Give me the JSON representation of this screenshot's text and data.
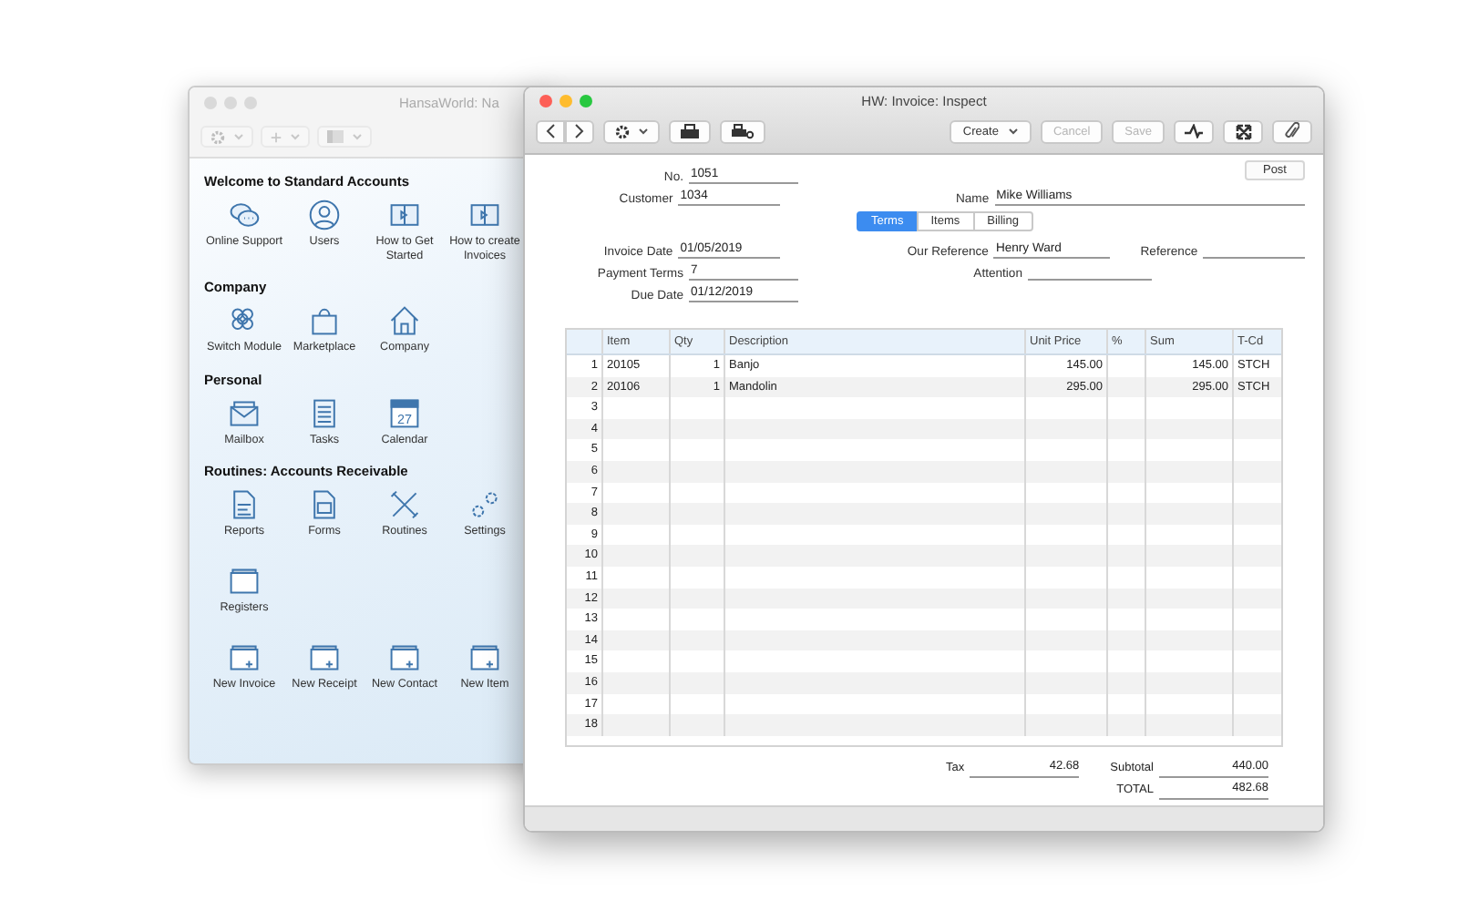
{
  "back_window": {
    "title": "HansaWorld: Na",
    "toolbar": [
      {
        "kind": "gear",
        "disabled": true
      },
      {
        "kind": "plus",
        "disabled": true
      },
      {
        "kind": "view",
        "disabled": true
      }
    ],
    "sections": [
      {
        "title": "Welcome to Standard Accounts",
        "items": [
          {
            "label": "Online Support",
            "kind": "chat"
          },
          {
            "label": "Users",
            "kind": "person"
          },
          {
            "label": "How to Get Started",
            "kind": "book"
          },
          {
            "label": "How to create Invoices",
            "kind": "book"
          }
        ]
      },
      {
        "title": "Company",
        "items": [
          {
            "label": "Switch Module",
            "kind": "cubes"
          },
          {
            "label": "Marketplace",
            "kind": "bag"
          },
          {
            "label": "Company",
            "kind": "house"
          }
        ]
      },
      {
        "title": "Personal",
        "items": [
          {
            "label": "Mailbox",
            "kind": "envelope"
          },
          {
            "label": "Tasks",
            "kind": "document"
          },
          {
            "label": "Calendar",
            "kind": "calendar",
            "badge": "27"
          }
        ]
      },
      {
        "title": "Routines: Accounts Receivable",
        "items": [
          {
            "label": "Reports",
            "kind": "report"
          },
          {
            "label": "Forms",
            "kind": "form"
          },
          {
            "label": "Routines",
            "kind": "tools"
          },
          {
            "label": "Settings",
            "kind": "gears"
          },
          {
            "label": "Registers",
            "kind": "folder"
          }
        ]
      },
      {
        "items": [
          {
            "label": "New Invoice",
            "kind": "folder-plus"
          },
          {
            "label": "New Receipt",
            "kind": "folder-plus"
          },
          {
            "label": "New Contact",
            "kind": "folder-plus"
          },
          {
            "label": "New Item",
            "kind": "folder-plus"
          }
        ]
      }
    ]
  },
  "window": {
    "title": "HW: Invoice: Inspect",
    "toolbar_left": [
      {
        "kind": "back"
      },
      {
        "kind": "forward"
      },
      {
        "kind": "gear-menu"
      },
      {
        "kind": "print"
      },
      {
        "kind": "print-preview"
      }
    ],
    "toolbar_right": [
      {
        "kind": "menu",
        "label": "Create",
        "disabled": false
      },
      {
        "kind": "text",
        "label": "Cancel",
        "disabled": true
      },
      {
        "kind": "text",
        "label": "Save",
        "disabled": true
      },
      {
        "kind": "wave"
      },
      {
        "kind": "expand"
      },
      {
        "kind": "clip"
      }
    ]
  },
  "form": {
    "number": {
      "label": "No.",
      "value": "1051"
    },
    "customer": {
      "label": "Customer",
      "value": "1034"
    },
    "name": {
      "label": "Name",
      "value": "Mike Williams"
    },
    "post_button": "Post",
    "tabs": [
      {
        "label": "Terms",
        "selected": true
      },
      {
        "label": "Items",
        "selected": false
      },
      {
        "label": "Billing",
        "selected": false
      }
    ],
    "left_fields": [
      {
        "label": "Invoice Date",
        "value": "01/05/2019"
      },
      {
        "label": "Payment Terms",
        "value": "7"
      },
      {
        "label": "Due Date",
        "value": "01/12/2019"
      }
    ],
    "middle_fields": [
      {
        "label": "Our Reference",
        "value": "Henry Ward"
      },
      {
        "label": "Attention"
      }
    ],
    "right_fields": [
      {
        "label": "Reference"
      }
    ]
  },
  "table": {
    "columns": [
      {
        "label": "Item",
        "kind": "text"
      },
      {
        "label": "Qty",
        "kind": "number"
      },
      {
        "label": "Description",
        "kind": "text"
      },
      {
        "label": "Unit Price",
        "kind": "number"
      },
      {
        "label": "%",
        "kind": "number"
      },
      {
        "label": "Sum",
        "kind": "number"
      },
      {
        "label": "T-Cd",
        "kind": "text"
      }
    ],
    "rows": [
      {
        "number": "1",
        "item": "20105",
        "qty": "1",
        "description": "Banjo",
        "unit_price": "145.00",
        "sum": "145.00",
        "t_cd": "STCH"
      },
      {
        "number": "2",
        "item": "20106",
        "qty": "1",
        "description": "Mandolin",
        "unit_price": "295.00",
        "sum": "295.00",
        "t_cd": "STCH"
      },
      {
        "number": "3"
      },
      {
        "number": "4"
      },
      {
        "number": "5"
      },
      {
        "number": "6"
      },
      {
        "number": "7"
      },
      {
        "number": "8"
      },
      {
        "number": "9"
      },
      {
        "number": "10"
      },
      {
        "number": "11"
      },
      {
        "number": "12"
      },
      {
        "number": "13"
      },
      {
        "number": "14"
      },
      {
        "number": "15"
      },
      {
        "number": "16"
      },
      {
        "number": "17"
      },
      {
        "number": "18"
      }
    ]
  },
  "totals": [
    {
      "label": "Tax",
      "value": "42.68"
    },
    {
      "label": "Subtotal",
      "value": "440.00"
    },
    {
      "label": "TOTAL",
      "value": "482.68"
    }
  ]
}
